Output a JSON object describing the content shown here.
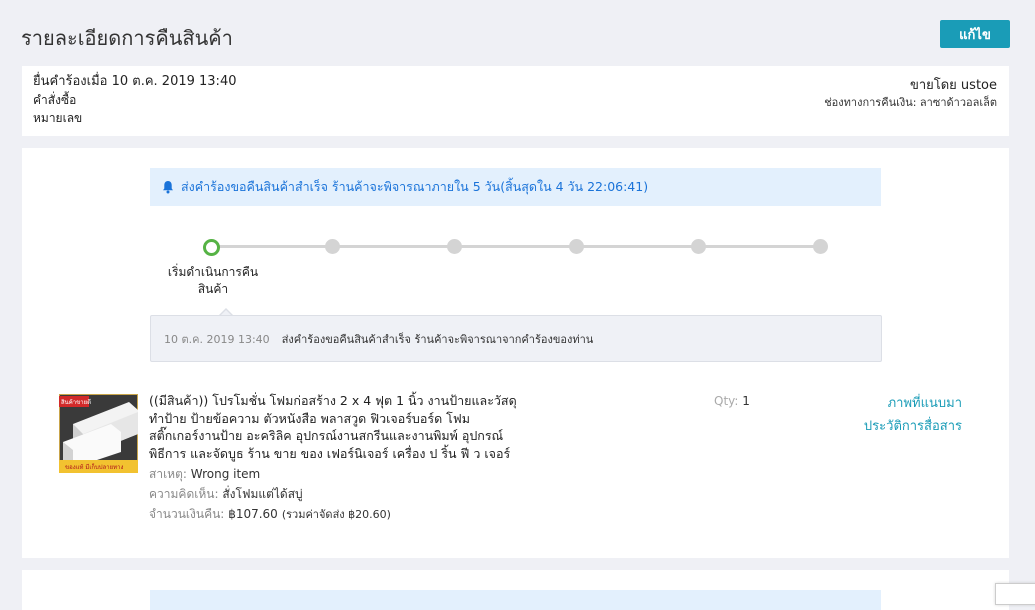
{
  "header": {
    "title": "รายละเอียดการคืนสินค้า",
    "edit_label": "แก้ไข"
  },
  "info": {
    "submitted_line": "ยื่นคำร้องเมื่อ 10 ต.ค. 2019 13:40",
    "order_label": "คำสั่งซื้อ",
    "number_label": "หมายเลข",
    "seller": "ขายโดย ustoe",
    "refund_channel": "ช่องทางการคืนเงิน: ลาซาด้าวอลเล็ต"
  },
  "notice": {
    "text": "ส่งคำร้องขอคืนสินค้าสำเร็จ ร้านค้าจะพิจารณาภายใน 5 วัน(สิ้นสุดใน 4 วัน 22:06:41)"
  },
  "progress": {
    "step_count": 6,
    "active_step": 1,
    "active_label": "เริ่มดำเนินการคืนสินค้า"
  },
  "history": {
    "timestamp": "10 ต.ค. 2019 13:40",
    "message": "ส่งคำร้องขอคืนสินค้าสำเร็จ ร้านค้าจะพิจารณาจากคำร้องของท่าน"
  },
  "product": {
    "name": "((มีสินค้า)) โปรโมชั่น โฟมก่อสร้าง 2 x 4 ฟุต 1 นิ้ว งานป้ายและวัสดุทำป้าย ป้ายข้อความ ตัวหนังสือ พลาสวูด ฟิวเจอร์บอร์ด โฟมสติ๊กเกอร์งานป้าย อะคริลิค อุปกรณ์งานสกรีนและงานพิมพ์ อุปกรณ์พิธีการ และจัดบูธ ร้าน ขาย ของ เฟอร์นิเจอร์ เครื่อง ป ริ้น ฟี ว เจอร์",
    "thumb_badge": "สินค้าขายดี",
    "thumb_banner": "ของแท้ มีเก็บปลายทาง",
    "reason_label": "สาเหตุ:",
    "reason_value": "Wrong item",
    "comment_label": "ความคิดเห็น:",
    "comment_value": "สั่งโฟมแต่ได้สบู่",
    "refund_label": "จำนวนเงินคืน:",
    "refund_value": "฿107.60",
    "shipping_note": "(รวมค่าจัดส่ง ฿20.60)",
    "qty_label": "Qty:",
    "qty_value": "1",
    "attachments_link": "ภาพที่แนบมา",
    "history_link": "ประวัติการสื่อสาร"
  },
  "colors": {
    "accent": "#1a9cb7",
    "notice_bg": "#e3f0fd",
    "notice_text": "#1a73d9",
    "step_active": "#56b345",
    "step_inactive": "#d4d4d4"
  }
}
